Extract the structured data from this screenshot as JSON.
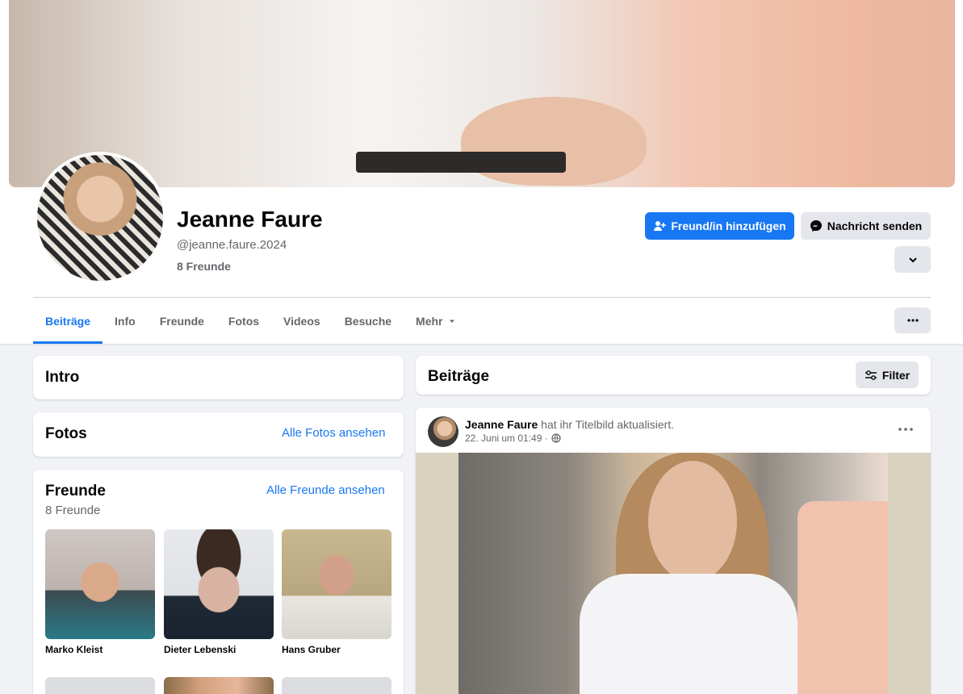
{
  "profile": {
    "name": "Jeanne Faure",
    "handle": "@jeanne.faure.2024",
    "friends_count": "8 Freunde"
  },
  "actions": {
    "add_friend": "Freund/in hinzufügen",
    "message": "Nachricht senden"
  },
  "tabs": [
    {
      "label": "Beiträge",
      "active": true
    },
    {
      "label": "Info"
    },
    {
      "label": "Freunde"
    },
    {
      "label": "Fotos"
    },
    {
      "label": "Videos"
    },
    {
      "label": "Besuche"
    },
    {
      "label": "Mehr"
    }
  ],
  "intro": {
    "title": "Intro"
  },
  "photos": {
    "title": "Fotos",
    "link": "Alle Fotos ansehen"
  },
  "friends": {
    "title": "Freunde",
    "count": "8 Freunde",
    "link": "Alle Freunde ansehen",
    "list": [
      {
        "name": "Marko Kleist"
      },
      {
        "name": "Dieter Lebenski"
      },
      {
        "name": "Hans Gruber"
      }
    ]
  },
  "posts": {
    "title": "Beiträge",
    "filter": "Filter",
    "item": {
      "author": "Jeanne Faure",
      "action": "hat ihr Titelbild aktualisiert.",
      "time": "22. Juni um 01:49 ·"
    }
  },
  "colors": {
    "accent": "#1877f2",
    "background": "#f0f2f5",
    "button_gray": "#e4e6eb"
  }
}
